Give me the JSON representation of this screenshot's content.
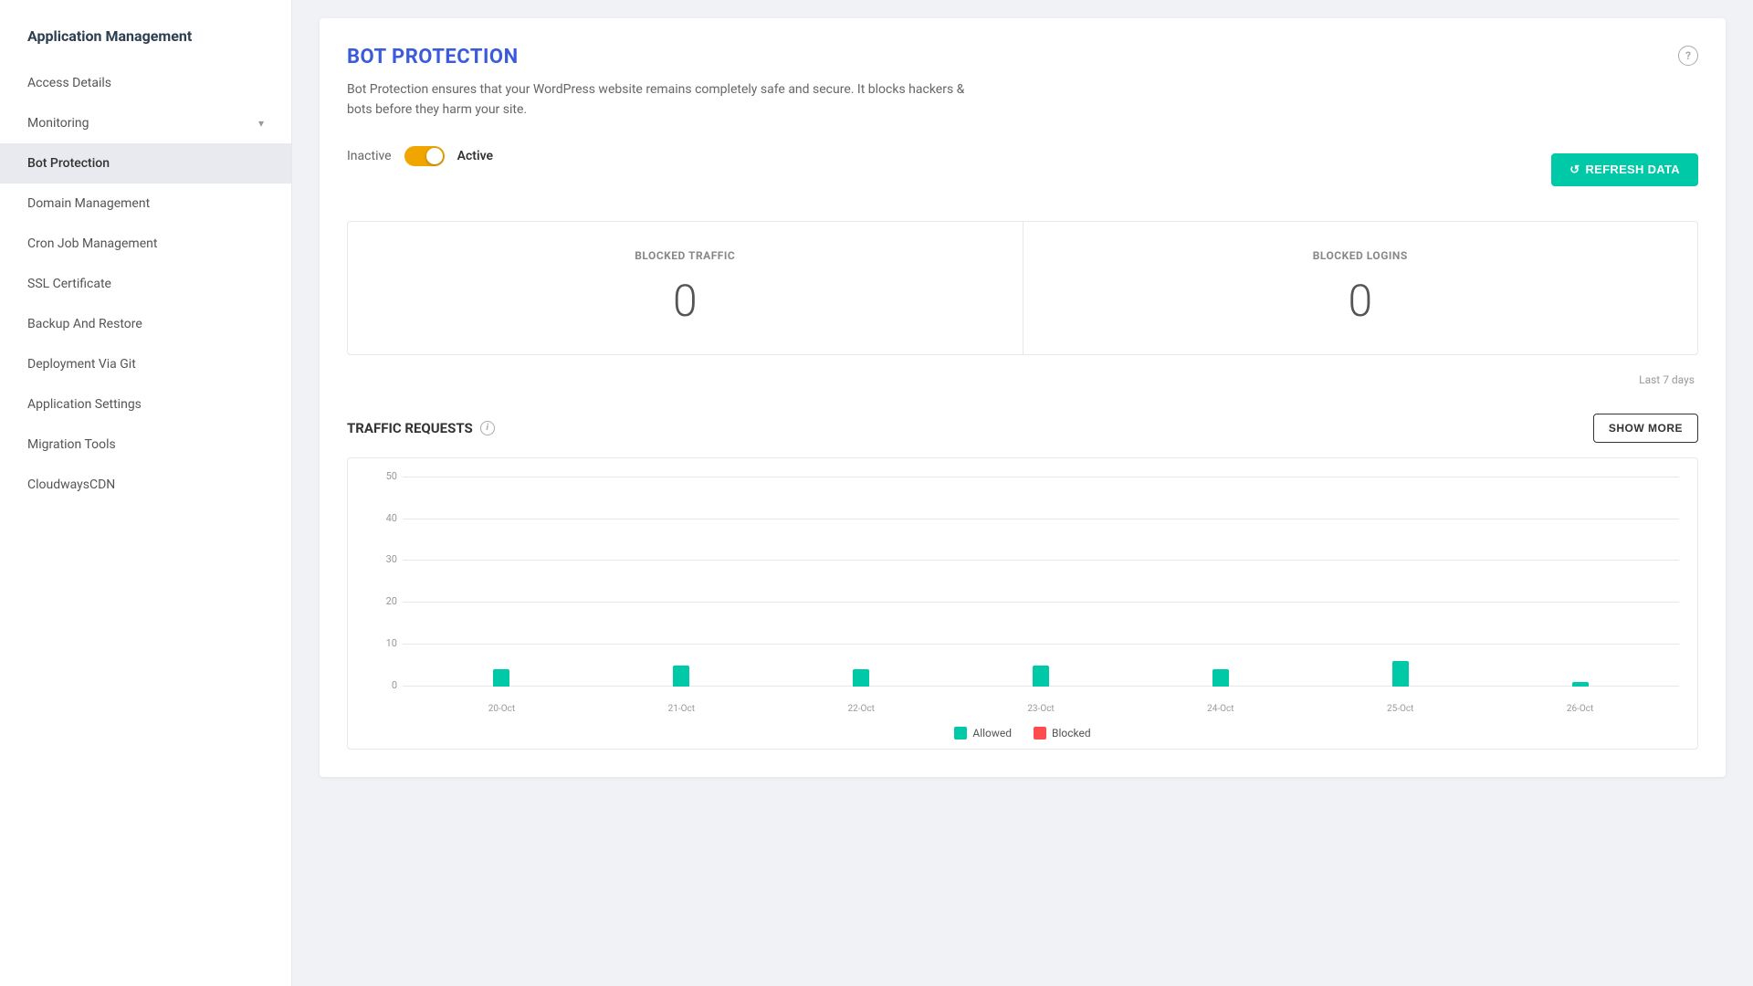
{
  "sidebar": {
    "title": "Application Management",
    "items": [
      {
        "id": "access-details",
        "label": "Access Details",
        "active": false,
        "hasChevron": false
      },
      {
        "id": "monitoring",
        "label": "Monitoring",
        "active": false,
        "hasChevron": true
      },
      {
        "id": "bot-protection",
        "label": "Bot Protection",
        "active": true,
        "hasChevron": false
      },
      {
        "id": "domain-management",
        "label": "Domain Management",
        "active": false,
        "hasChevron": false
      },
      {
        "id": "cron-job-management",
        "label": "Cron Job Management",
        "active": false,
        "hasChevron": false
      },
      {
        "id": "ssl-certificate",
        "label": "SSL Certificate",
        "active": false,
        "hasChevron": false
      },
      {
        "id": "backup-and-restore",
        "label": "Backup And Restore",
        "active": false,
        "hasChevron": false
      },
      {
        "id": "deployment-via-git",
        "label": "Deployment Via Git",
        "active": false,
        "hasChevron": false
      },
      {
        "id": "application-settings",
        "label": "Application Settings",
        "active": false,
        "hasChevron": false
      },
      {
        "id": "migration-tools",
        "label": "Migration Tools",
        "active": false,
        "hasChevron": false
      },
      {
        "id": "cloudwayscdn",
        "label": "CloudwaysCDN",
        "active": false,
        "hasChevron": false
      }
    ]
  },
  "main": {
    "page_title": "BOT PROTECTION",
    "description": "Bot Protection ensures that your WordPress website remains completely safe and secure. It blocks hackers & bots before they harm your site.",
    "toggle": {
      "inactive_label": "Inactive",
      "active_label": "Active",
      "is_active": true
    },
    "refresh_button_label": "REFRESH DATA",
    "stats": [
      {
        "id": "blocked-traffic",
        "label": "BLOCKED TRAFFIC",
        "value": "0"
      },
      {
        "id": "blocked-logins",
        "label": "BLOCKED LOGINS",
        "value": "0"
      }
    ],
    "last_updated": "Last 7 days",
    "traffic_section": {
      "title": "TRAFFIC REQUESTS",
      "show_more_label": "SHOW MORE",
      "chart": {
        "y_labels": [
          "50",
          "40",
          "30",
          "20",
          "10",
          "0"
        ],
        "bars": [
          {
            "date": "20-Oct",
            "allowed": 4,
            "blocked": 0
          },
          {
            "date": "21-Oct",
            "allowed": 5,
            "blocked": 0
          },
          {
            "date": "22-Oct",
            "allowed": 4,
            "blocked": 0
          },
          {
            "date": "23-Oct",
            "allowed": 5,
            "blocked": 0
          },
          {
            "date": "24-Oct",
            "allowed": 4,
            "blocked": 0
          },
          {
            "date": "25-Oct",
            "allowed": 6,
            "blocked": 0
          },
          {
            "date": "26-Oct",
            "allowed": 1,
            "blocked": 0
          }
        ],
        "y_max": 50,
        "legend": {
          "allowed_label": "Allowed",
          "blocked_label": "Blocked"
        }
      }
    }
  },
  "icons": {
    "refresh": "↺",
    "chevron_down": "▾",
    "help": "?",
    "info": "i"
  },
  "colors": {
    "primary_blue": "#3b5bdb",
    "teal": "#00c9a7",
    "orange": "#f0a500",
    "red": "#ff4d4f",
    "active_bg": "#e8eaf0"
  }
}
